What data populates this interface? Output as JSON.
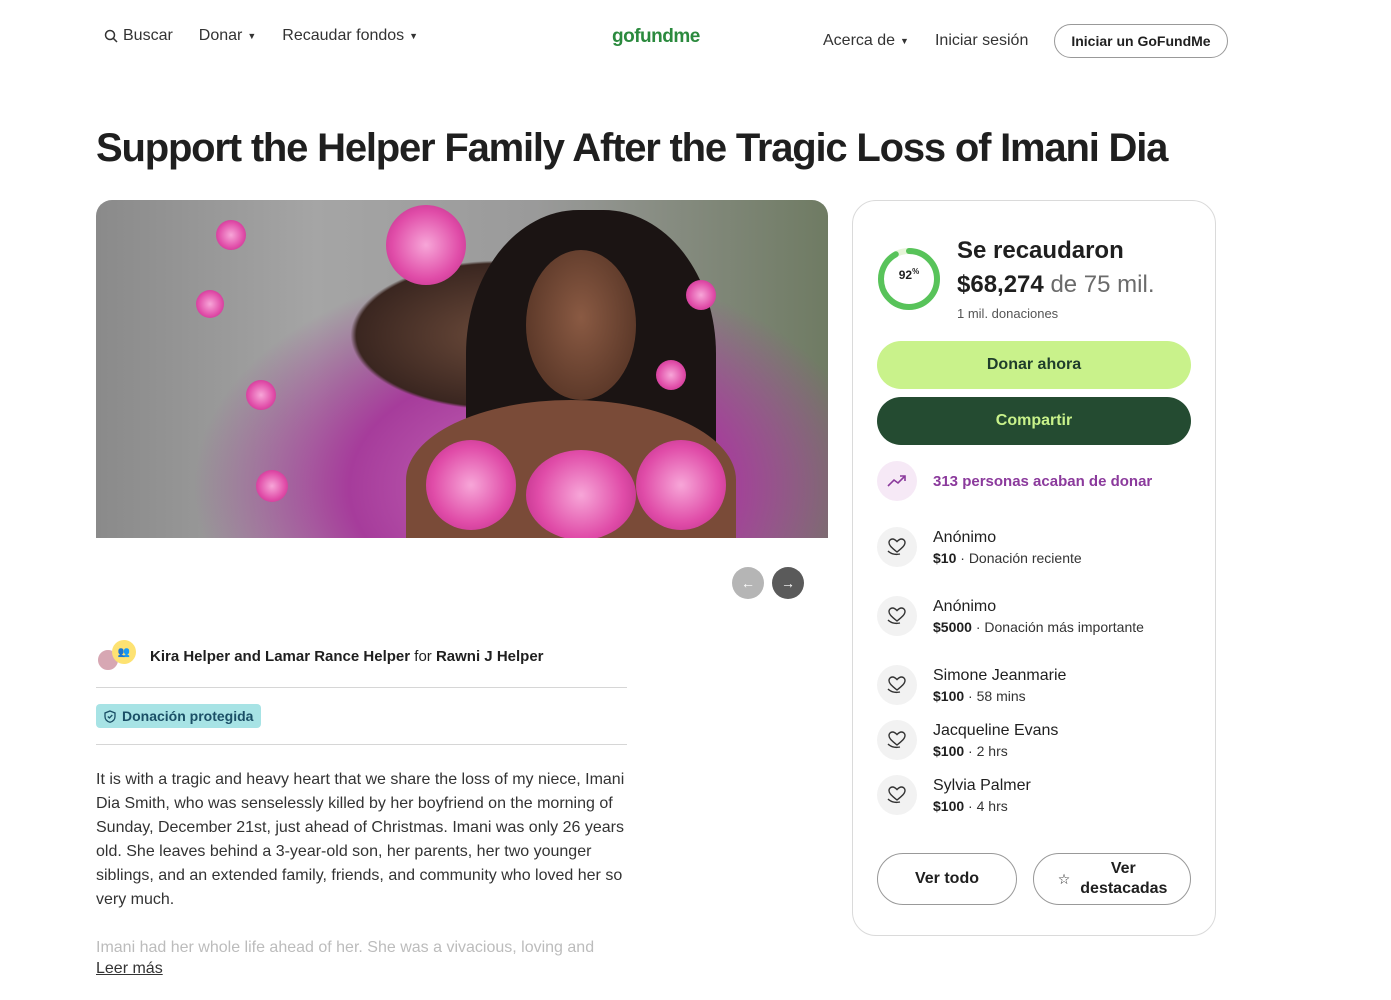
{
  "header": {
    "search": "Buscar",
    "donate": "Donar",
    "fundraise": "Recaudar fondos",
    "logo": "gofundme",
    "about": "Acerca de",
    "login": "Iniciar sesión",
    "start": "Iniciar un GoFundMe"
  },
  "campaign": {
    "title": "Support the Helper Family After the Tragic Loss of Imani Dia",
    "organizers": "Kira Helper and Lamar Rance Helper",
    "for_word": "for",
    "beneficiary": "Rawni J Helper",
    "protected": "Donación protegida",
    "story": "It is with a tragic and heavy heart that we share the loss of my niece, Imani Dia Smith, who was senselessly killed by her boyfriend on the morning of Sunday, December 21st, just ahead of Christmas. Imani was only 26 years old. She leaves behind a 3-year-old son, her parents, her two younger siblings, and an extended family, friends, and community who loved her so very much.",
    "story_faded": "Imani had her whole life ahead of her. She was a vivacious, loving and",
    "read_more": "Leer más"
  },
  "progress": {
    "percent_label": "92",
    "percent_sign": "%",
    "fraction": 0.92,
    "title": "Se recaudaron",
    "raised": "$68,274",
    "goal": "de 75 mil.",
    "donations": "1 mil. donaciones"
  },
  "actions": {
    "donate": "Donar ahora",
    "share": "Compartir"
  },
  "trend": "313 personas acaban de donar",
  "donors": [
    {
      "name": "Anónimo",
      "amount": "$10",
      "meta": "Donación reciente"
    },
    {
      "name": "Anónimo",
      "amount": "$5000",
      "meta": "Donación más importante"
    },
    {
      "name": "Simone Jeanmarie",
      "amount": "$100",
      "meta": "58 mins"
    },
    {
      "name": "Jacqueline Evans",
      "amount": "$100",
      "meta": "2 hrs"
    },
    {
      "name": "Sylvia Palmer",
      "amount": "$100",
      "meta": "4 hrs"
    }
  ],
  "footer_buttons": {
    "see_all": "Ver todo",
    "see_featured": "Ver destacadas"
  },
  "colors": {
    "brand_green": "#2b8a3e",
    "donate_bg": "#c9f28b",
    "share_bg": "#244b31",
    "trend_purple": "#8b3a9c",
    "protected_bg": "#a7e3e5"
  }
}
